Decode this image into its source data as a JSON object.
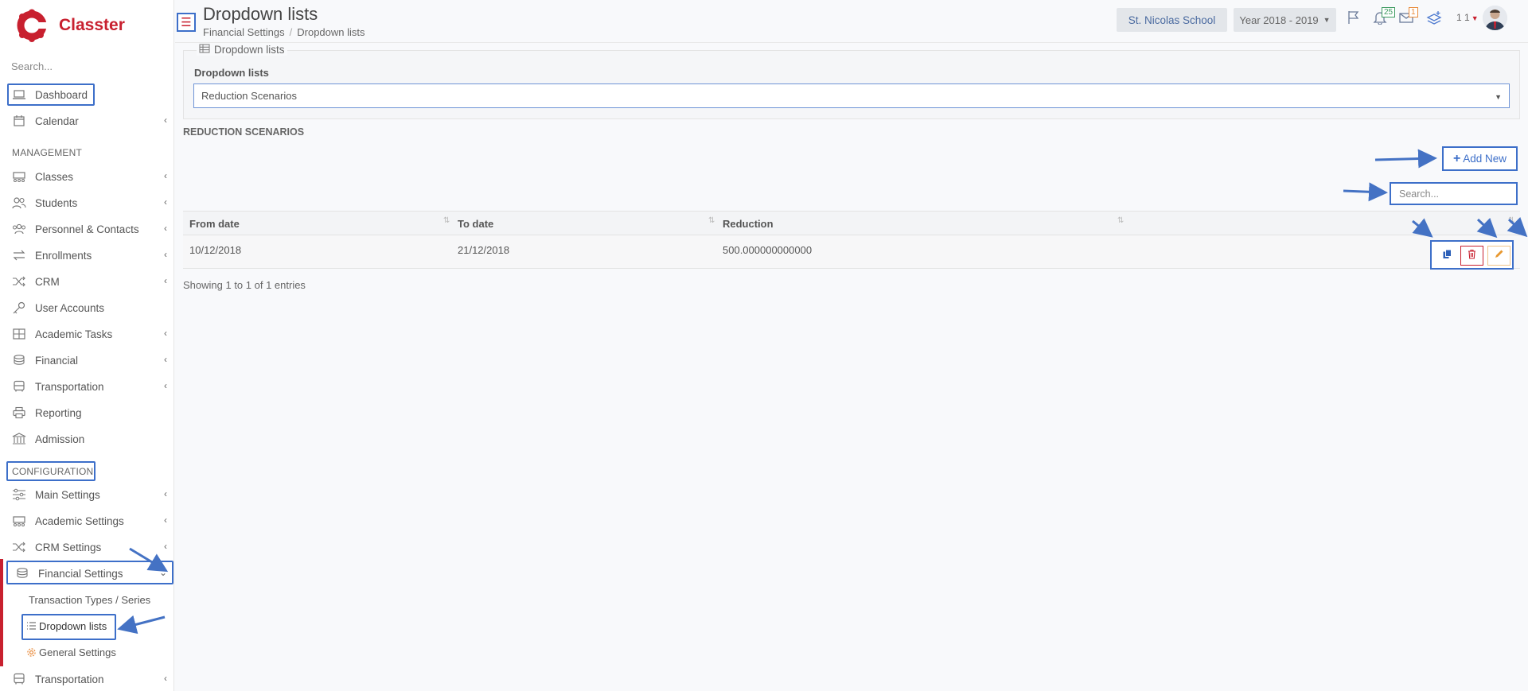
{
  "app": {
    "name": "Classter",
    "brand_color": "#c8202f",
    "highlight_color": "#3d6fc9"
  },
  "sidebar": {
    "search_placeholder": "Search...",
    "dashboard": "Dashboard",
    "calendar": "Calendar",
    "management_label": "MANAGEMENT",
    "management": [
      {
        "label": "Classes",
        "icon": "classes-icon"
      },
      {
        "label": "Students",
        "icon": "students-icon"
      },
      {
        "label": "Personnel & Contacts",
        "icon": "personnel-icon"
      },
      {
        "label": "Enrollments",
        "icon": "enrollments-icon"
      },
      {
        "label": "CRM",
        "icon": "crm-icon"
      },
      {
        "label": "User Accounts",
        "icon": "key-icon"
      },
      {
        "label": "Academic Tasks",
        "icon": "academic-tasks-icon"
      },
      {
        "label": "Financial",
        "icon": "coins-icon"
      },
      {
        "label": "Transportation",
        "icon": "bus-icon"
      },
      {
        "label": "Reporting",
        "icon": "printer-icon"
      },
      {
        "label": "Admission",
        "icon": "bank-icon"
      }
    ],
    "configuration_label": "CONFIGURATION",
    "configuration": [
      {
        "label": "Main Settings",
        "icon": "sliders-icon"
      },
      {
        "label": "Academic Settings",
        "icon": "classes-icon"
      },
      {
        "label": "CRM Settings",
        "icon": "crm-icon"
      },
      {
        "label": "Financial Settings",
        "icon": "coins-icon"
      }
    ],
    "financial_sub": {
      "transaction_types": "Transaction Types / Series",
      "dropdown_lists": "Dropdown lists",
      "general_settings": "General Settings"
    },
    "transportation": "Transportation"
  },
  "header": {
    "title": "Dropdown lists",
    "breadcrumb": [
      "Financial Settings",
      "Dropdown lists"
    ],
    "school": "St. Nicolas School",
    "year": "Year 2018 - 2019",
    "notifications_count": "25",
    "messages_count": "1",
    "user_count": "1 1"
  },
  "main": {
    "legend": "Dropdown lists",
    "field_label": "Dropdown lists",
    "selected_list": "Reduction Scenarios",
    "section_title": "REDUCTION SCENARIOS",
    "add_new_label": "Add New",
    "search_placeholder": "Search...",
    "table": {
      "columns": [
        "From date",
        "To date",
        "Reduction"
      ],
      "rows": [
        {
          "from": "10/12/2018",
          "to": "21/12/2018",
          "reduction": "500.000000000000"
        }
      ]
    },
    "entries_info": "Showing 1 to 1 of 1 entries"
  }
}
